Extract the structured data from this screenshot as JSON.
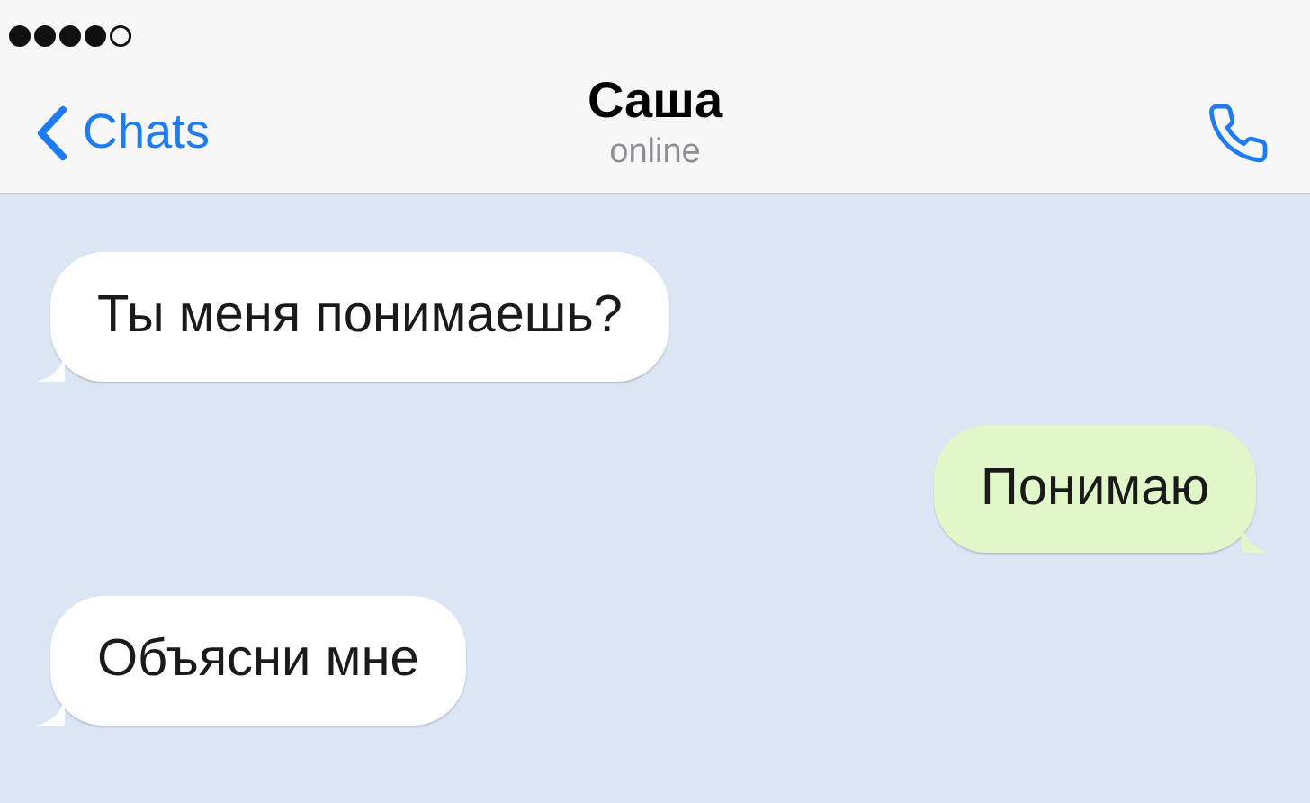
{
  "header": {
    "back_label": "Chats",
    "title": "Саша",
    "subtitle": "online"
  },
  "messages": [
    {
      "text": "Ты меня понимаешь?",
      "kind": "incoming"
    },
    {
      "text": "Понимаю",
      "kind": "outgoing"
    },
    {
      "text": "Объясни мне",
      "kind": "incoming"
    }
  ]
}
